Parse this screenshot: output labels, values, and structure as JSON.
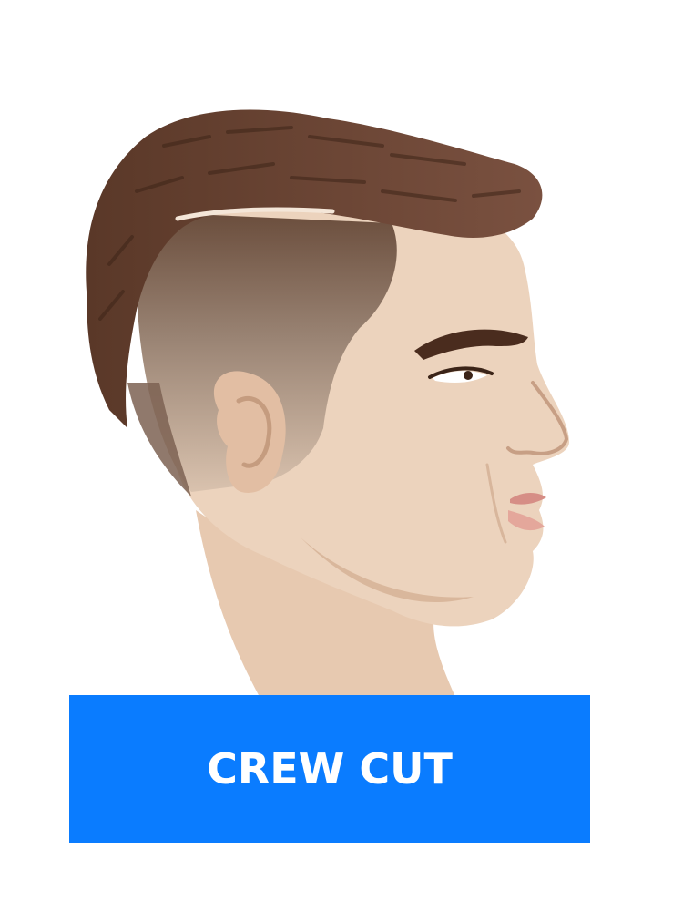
{
  "haircut": {
    "name": "CREW CUT",
    "illustration": "head-profile-crew-cut"
  },
  "colors": {
    "banner": "#0a7cff",
    "banner_text": "#ffffff",
    "hair": "#5a3a2a",
    "skin": "#ecd3bd"
  }
}
